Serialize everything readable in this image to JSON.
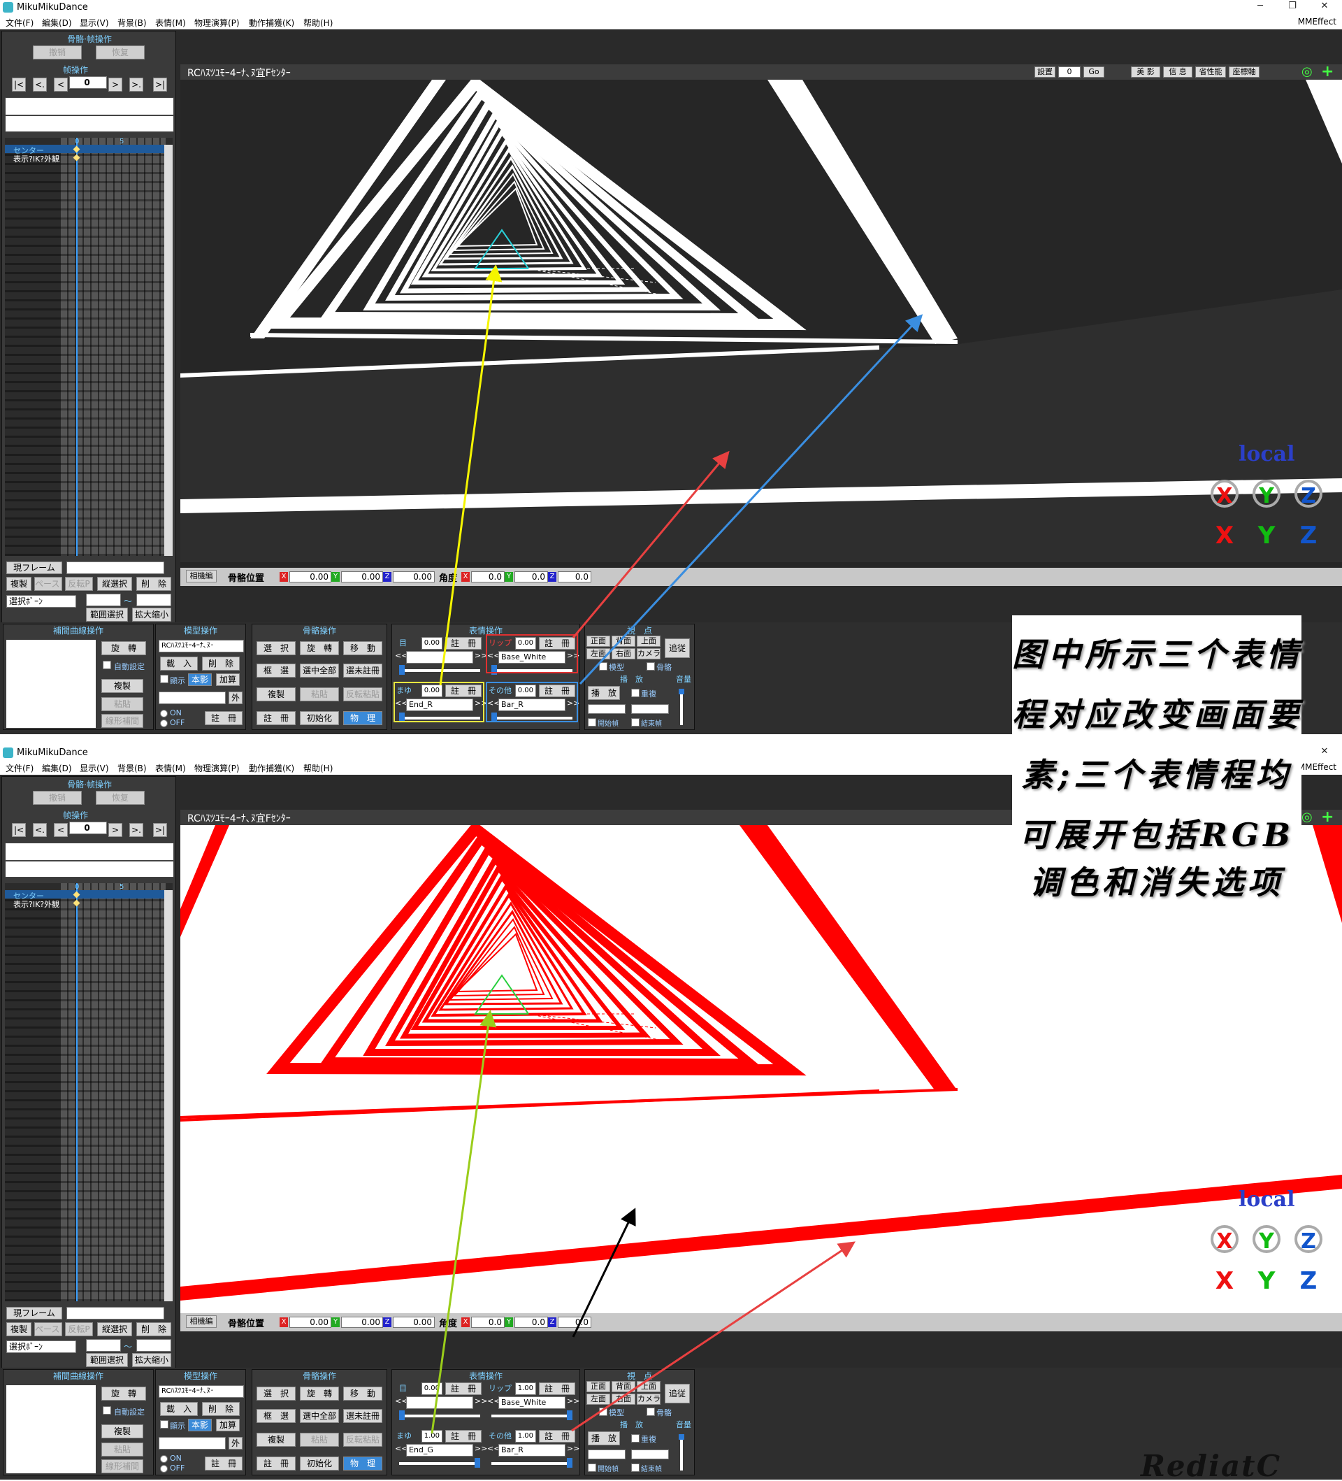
{
  "app": {
    "title": "MikuMikuDance",
    "mme": "MMEffect",
    "min": "─",
    "restore": "❐",
    "close": "✕"
  },
  "menu": [
    "文件(F)",
    "編集(D)",
    "显示(V)",
    "背景(B)",
    "表情(M)",
    "物理演算(P)",
    "動作捕獲(K)",
    "帮助(H)"
  ],
  "left": {
    "bone_frame_op": "骨骼·帧操作",
    "undo": "撤销",
    "redo": "恢复",
    "frame_op": "帧操作",
    "nav": [
      "|<",
      "<.",
      "<",
      "0",
      ">",
      ">.",
      ">|"
    ],
    "timeline_ticks": [
      "0",
      "5"
    ],
    "bones": [
      "センター",
      "表示?IK?外観"
    ],
    "current_frame": "現フレーム",
    "copy": "複製",
    "paste": "ペースト",
    "reverse": "反転P",
    "vertical_select": "縦選択",
    "delete": "削　除",
    "select_bone": "選択ﾎﾞｰﾝ",
    "tilde": "～",
    "range_select": "範囲選択",
    "zoom": "拡大縮小"
  },
  "viewport": {
    "model_title": "RCﾊｽﾂﾕﾓｰ4ｰﾅ､ﾇ宜Fｾﾝﾀｰ",
    "toolbar": [
      "設置",
      "0",
      "Go",
      "美 影",
      "信 息",
      "省性能",
      "座標軸"
    ],
    "local": "local",
    "gizmo_rot": [
      "X",
      "Y",
      "Z"
    ],
    "gizmo_move": [
      "X",
      "Y",
      "Z"
    ]
  },
  "bonebar": {
    "camera": "相機編",
    "position": "骨骼位置",
    "angle": "角度",
    "pos": [
      "0.00",
      "0.00",
      "0.00"
    ],
    "rot": [
      "0.0",
      "0.0",
      "0.0"
    ],
    "axes": [
      "X",
      "Y",
      "Z"
    ]
  },
  "bottom": {
    "curve_op": "補間曲線操作",
    "rotate": "旋　轉",
    "auto_set": "自動設定",
    "copy": "複製",
    "paste": "粘貼",
    "linear": "線形補間",
    "model_op": "模型操作",
    "model_sel": "RCﾊｽﾂﾕﾓｰ4ｰﾅ､ﾇ･",
    "load": "載　入",
    "delete": "削　除",
    "show": "顯示",
    "shadow": "本影",
    "add": "加算",
    "outside": "外",
    "on": "ON",
    "off": "OFF",
    "register": "註　冊",
    "bone_op": "骨骼操作",
    "select": "選　択",
    "rotate2": "旋　轉",
    "move": "移　動",
    "frame_sel": "框　選",
    "select_all": "選中全部",
    "select_unreg": "選未註冊",
    "copy2": "複製",
    "paste2": "粘貼",
    "rev_paste": "反転粘貼",
    "register2": "註　冊",
    "init": "初始化",
    "physics": "物　理",
    "face_op": "表情操作",
    "eye": "目",
    "lip": "リップ",
    "brow": "まゆ",
    "other": "その他",
    "reg": "註　冊",
    "view": "視　点",
    "front": "正面",
    "back": "背面",
    "top": "上面",
    "left": "左面",
    "right": "右面",
    "camera": "カメラ",
    "follow": "追従",
    "model": "模型",
    "bone": "骨骼",
    "play": "播　放",
    "play_btn": "播　放",
    "repeat": "重複",
    "start": "開始幀",
    "end": "結束幀",
    "volume": "音量",
    "dbl_left": "<<",
    "dbl_right": ">>"
  },
  "win1": {
    "eye_val": "0.00",
    "lip_val": "0.00",
    "brow_val": "0.00",
    "other_val": "0.00",
    "eye_sel": "",
    "lip_sel": "Base_White",
    "brow_sel": "End_R",
    "other_sel": "Bar_R"
  },
  "win2": {
    "eye_val": "0.00",
    "lip_val": "1.00",
    "brow_val": "1.00",
    "other_val": "1.00",
    "eye_sel": "",
    "lip_sel": "Base_White",
    "brow_sel": "End_G",
    "other_sel": "Bar_R"
  },
  "note": [
    "图中所示三个表情",
    "程对应改变画面要",
    "素;三个表情程均",
    "可展开包括RGB",
    "调色和消失选项"
  ],
  "signature": "RediatC",
  "colors": {
    "accent": "#7fd0ff",
    "arrow_yellow": "#f5f500",
    "arrow_blue": "#3a8ee0",
    "arrow_red": "#e84040",
    "arrow_lime": "#9acd1a",
    "arrow_black": "#000000",
    "stripe_red": "#ff0000"
  }
}
